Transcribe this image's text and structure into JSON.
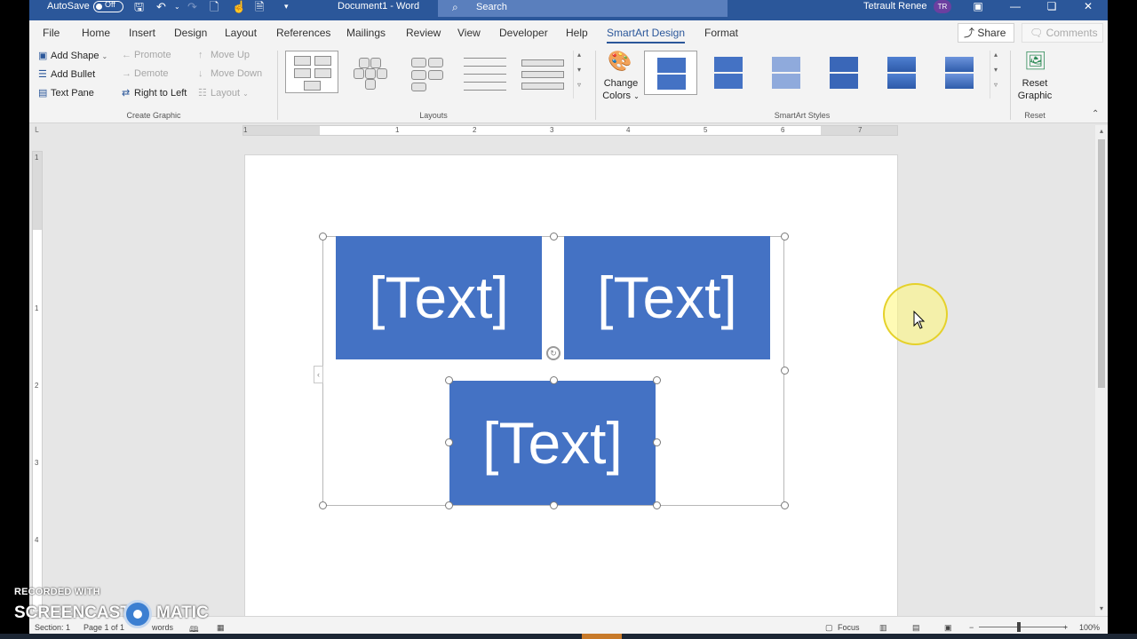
{
  "titlebar": {
    "autosave_label": "AutoSave",
    "autosave_state": "Off",
    "doc_title": "Document1 - Word",
    "search_placeholder": "Search",
    "user_name": "Tetrault Renee",
    "user_initials": "TR"
  },
  "tabs": [
    "File",
    "Home",
    "Insert",
    "Design",
    "Layout",
    "References",
    "Mailings",
    "Review",
    "View",
    "Developer",
    "Help",
    "SmartArt Design",
    "Format"
  ],
  "active_tab": "SmartArt Design",
  "share_label": "Share",
  "comments_label": "Comments",
  "ribbon": {
    "create_graphic": {
      "add_shape": "Add Shape",
      "promote": "Promote",
      "move_up": "Move Up",
      "add_bullet": "Add Bullet",
      "demote": "Demote",
      "move_down": "Move Down",
      "text_pane": "Text Pane",
      "right_to_left": "Right to Left",
      "layout": "Layout",
      "group_label": "Create Graphic"
    },
    "layouts_label": "Layouts",
    "change_colors_line1": "Change",
    "change_colors_line2": "Colors",
    "smartart_styles_label": "SmartArt Styles",
    "reset_graphic_line1": "Reset",
    "reset_graphic_line2": "Graphic",
    "reset_label": "Reset"
  },
  "ruler": {
    "h_numbers": [
      "1",
      "1",
      "2",
      "3",
      "4",
      "5",
      "6",
      "7"
    ],
    "v_numbers": [
      "1",
      "1",
      "2",
      "3",
      "4"
    ]
  },
  "smartart": {
    "shape_texts": [
      "[Text]",
      "[Text]",
      "[Text]"
    ],
    "shape_color": "#4472c4"
  },
  "statusbar": {
    "section": "Section: 1",
    "page": "Page 1 of 1",
    "words": "words",
    "focus": "Focus",
    "zoom": "100%"
  },
  "watermark": {
    "line1": "RECORDED WITH",
    "left": "SCREENCAST",
    "right": "MATIC"
  },
  "colors": {
    "word_blue": "#2b579a",
    "accent": "#4472c4"
  }
}
